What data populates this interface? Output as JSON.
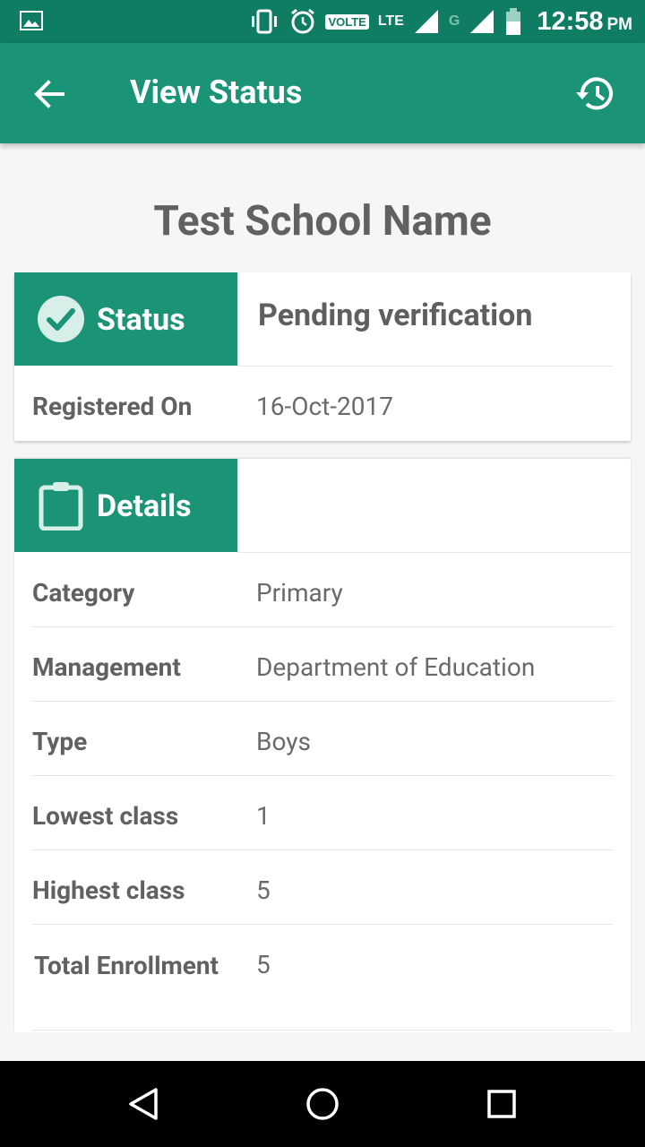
{
  "statusbar": {
    "icons": [
      "image-icon",
      "vibrate-icon",
      "alarm-icon",
      "volte-badge",
      "lte-signal-icon",
      "g-signal-icon",
      "battery-icon"
    ],
    "volte": "VOLTE",
    "lte": "LTE",
    "g": "G",
    "time": "12:58",
    "ampm": "PM"
  },
  "appbar": {
    "title": "View Status",
    "back_icon": "arrow-back-icon",
    "history_icon": "history-icon"
  },
  "school_name": "Test School Name",
  "status_card": {
    "header_label": "Status",
    "header_icon": "check-circle-icon",
    "status_value": "Pending verification",
    "registered_label": "Registered On",
    "registered_value": "16-Oct-2017"
  },
  "details_card": {
    "header_label": "Details",
    "header_icon": "clipboard-icon",
    "rows": [
      {
        "label": "Category",
        "value": "Primary"
      },
      {
        "label": "Management",
        "value": "Department of Education"
      },
      {
        "label": "Type",
        "value": "Boys"
      },
      {
        "label": "Lowest class",
        "value": "1"
      },
      {
        "label": "Highest class",
        "value": "5"
      },
      {
        "label": "Total Enrollment",
        "value": "5"
      }
    ]
  },
  "navbar": {
    "icons": [
      "back-triangle-icon",
      "home-circle-icon",
      "recents-square-icon"
    ]
  },
  "colors": {
    "statusbar": "#0f7d63",
    "primary": "#1a9377",
    "background": "#f6f6f6"
  }
}
